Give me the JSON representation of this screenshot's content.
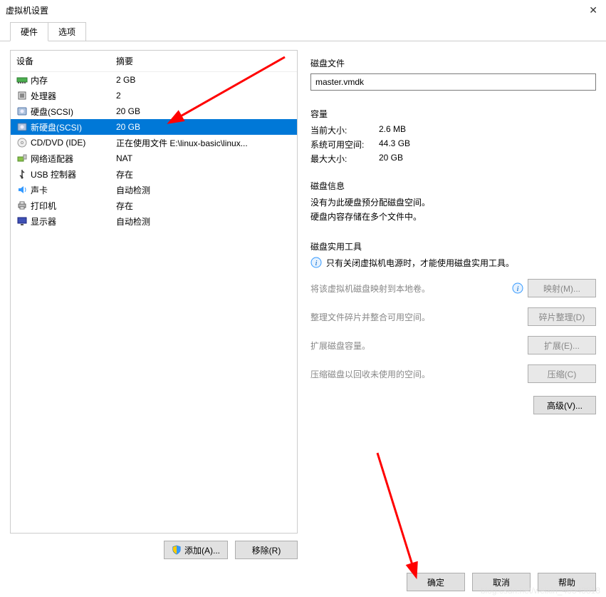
{
  "title": "虚拟机设置",
  "tabs": {
    "hardware": "硬件",
    "options": "选项"
  },
  "headers": {
    "device": "设备",
    "summary": "摘要"
  },
  "hardware": [
    {
      "icon": "memory-icon",
      "name": "内存",
      "summary": "2 GB"
    },
    {
      "icon": "cpu-icon",
      "name": "处理器",
      "summary": "2"
    },
    {
      "icon": "disk-icon",
      "name": "硬盘(SCSI)",
      "summary": "20 GB"
    },
    {
      "icon": "disk-icon",
      "name": "新硬盘(SCSI)",
      "summary": "20 GB",
      "selected": true
    },
    {
      "icon": "cd-icon",
      "name": "CD/DVD (IDE)",
      "summary": "正在使用文件 E:\\linux-basic\\linux..."
    },
    {
      "icon": "net-icon",
      "name": "网络适配器",
      "summary": "NAT"
    },
    {
      "icon": "usb-icon",
      "name": "USB 控制器",
      "summary": "存在"
    },
    {
      "icon": "sound-icon",
      "name": "声卡",
      "summary": "自动检测"
    },
    {
      "icon": "printer-icon",
      "name": "打印机",
      "summary": "存在"
    },
    {
      "icon": "display-icon",
      "name": "显示器",
      "summary": "自动检测"
    }
  ],
  "buttons": {
    "add": "添加(A)...",
    "remove": "移除(R)",
    "ok": "确定",
    "cancel": "取消",
    "help": "帮助"
  },
  "right": {
    "diskfile_label": "磁盘文件",
    "diskfile_value": "master.vmdk",
    "capacity_label": "容量",
    "current_size_label": "当前大小:",
    "current_size_value": "2.6 MB",
    "free_space_label": "系统可用空间:",
    "free_space_value": "44.3 GB",
    "max_size_label": "最大大小:",
    "max_size_value": "20 GB",
    "diskinfo_label": "磁盘信息",
    "diskinfo_1": "没有为此硬盘预分配磁盘空间。",
    "diskinfo_2": "硬盘内容存储在多个文件中。",
    "util_label": "磁盘实用工具",
    "util_note": "只有关闭虚拟机电源时，才能使用磁盘实用工具。",
    "map_desc": "将该虚拟机磁盘映射到本地卷。",
    "map_btn": "映射(M)...",
    "defrag_desc": "整理文件碎片并整合可用空间。",
    "defrag_btn": "碎片整理(D)",
    "expand_desc": "扩展磁盘容量。",
    "expand_btn": "扩展(E)...",
    "compact_desc": "压缩磁盘以回收未使用的空间。",
    "compact_btn": "压缩(C)",
    "advanced_btn": "高级(V)..."
  },
  "watermark": "blog.csdn.net/weixin_40543818"
}
